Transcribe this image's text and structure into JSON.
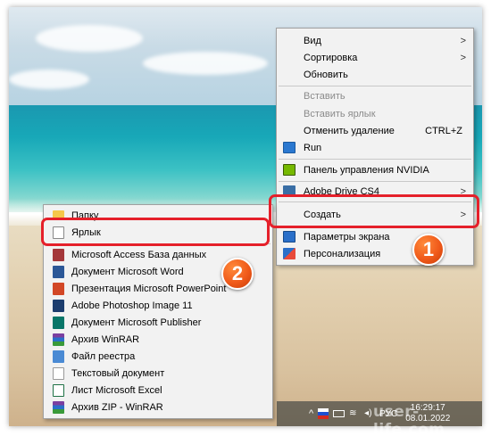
{
  "main_menu": {
    "items": [
      {
        "label": "Вид",
        "submenu": true,
        "disabled": false,
        "icon": ""
      },
      {
        "label": "Сортировка",
        "submenu": true,
        "disabled": false,
        "icon": ""
      },
      {
        "label": "Обновить",
        "submenu": false,
        "disabled": false,
        "icon": ""
      },
      {
        "label": "Вставить",
        "submenu": false,
        "disabled": true,
        "icon": ""
      },
      {
        "label": "Вставить ярлык",
        "submenu": false,
        "disabled": true,
        "icon": ""
      },
      {
        "label": "Отменить удаление",
        "shortcut": "CTRL+Z",
        "submenu": false,
        "disabled": false,
        "icon": ""
      },
      {
        "label": "Run",
        "submenu": false,
        "disabled": false,
        "icon": "run-icon"
      },
      {
        "label": "Панель управления NVIDIA",
        "submenu": false,
        "disabled": false,
        "icon": "nvidia-icon"
      },
      {
        "label": "Adobe Drive CS4",
        "submenu": true,
        "disabled": false,
        "icon": "adobe-drive-icon"
      },
      {
        "label": "Создать",
        "submenu": true,
        "disabled": false,
        "icon": ""
      },
      {
        "label": "Параметры экрана",
        "submenu": false,
        "disabled": false,
        "icon": "display-settings-icon"
      },
      {
        "label": "Персонализация",
        "submenu": false,
        "disabled": false,
        "icon": "personalization-icon"
      }
    ]
  },
  "sub_menu": {
    "items": [
      {
        "label": "Папку",
        "icon": "folder-icon"
      },
      {
        "label": "Ярлык",
        "icon": "shortcut-icon"
      },
      {
        "label": "Microsoft Access База данных",
        "icon": "access-icon"
      },
      {
        "label": "Документ Microsoft Word",
        "icon": "word-icon"
      },
      {
        "label": "Презентация Microsoft PowerPoint",
        "icon": "powerpoint-icon"
      },
      {
        "label": "Adobe Photoshop Image 11",
        "icon": "photoshop-icon"
      },
      {
        "label": "Документ Microsoft Publisher",
        "icon": "publisher-icon"
      },
      {
        "label": "Архив WinRAR",
        "icon": "winrar-icon"
      },
      {
        "label": "Файл реестра",
        "icon": "registry-icon"
      },
      {
        "label": "Текстовый документ",
        "icon": "text-document-icon"
      },
      {
        "label": "Лист Microsoft Excel",
        "icon": "excel-icon"
      },
      {
        "label": "Архив ZIP - WinRAR",
        "icon": "zip-icon"
      }
    ]
  },
  "badges": {
    "one": "1",
    "two": "2"
  },
  "taskbar": {
    "language": "РУС",
    "time": "16:29:17",
    "date": "08.01.2022"
  },
  "watermark": "user-life.com",
  "colors": {
    "highlight": "#e5202a",
    "badge": "#f05a1a",
    "menu_bg": "#f2f2f2"
  }
}
